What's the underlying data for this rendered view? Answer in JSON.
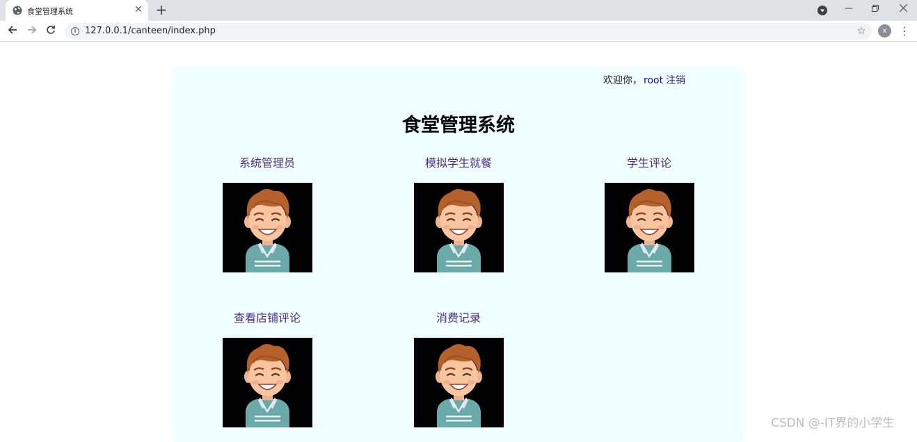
{
  "browser": {
    "tab_title": "食堂管理系统",
    "tab_close": "✕",
    "new_tab": "+",
    "url": "127.0.0.1/canteen/index.php",
    "profile_initial": "x",
    "icons": [
      "globe-icon",
      "close-icon",
      "plus-icon",
      "back-icon",
      "forward-icon",
      "reload-icon",
      "info-icon",
      "star-icon",
      "menu-icon",
      "minimize-icon",
      "restore-icon",
      "window-close-icon",
      "media-icon"
    ]
  },
  "header": {
    "welcome": "欢迎你，",
    "username": "root",
    "logout": "注销"
  },
  "page": {
    "title": "食堂管理系统"
  },
  "menu": [
    {
      "label": "系统管理员"
    },
    {
      "label": "模拟学生就餐"
    },
    {
      "label": "学生评论"
    },
    {
      "label": "查看店铺评论"
    },
    {
      "label": "消费记录"
    }
  ],
  "watermark": "CSDN @-IT界的小学生",
  "colors": {
    "panel_bg": "#f0ffff",
    "link": "#4b2a8c",
    "username": "#1a0dab"
  }
}
